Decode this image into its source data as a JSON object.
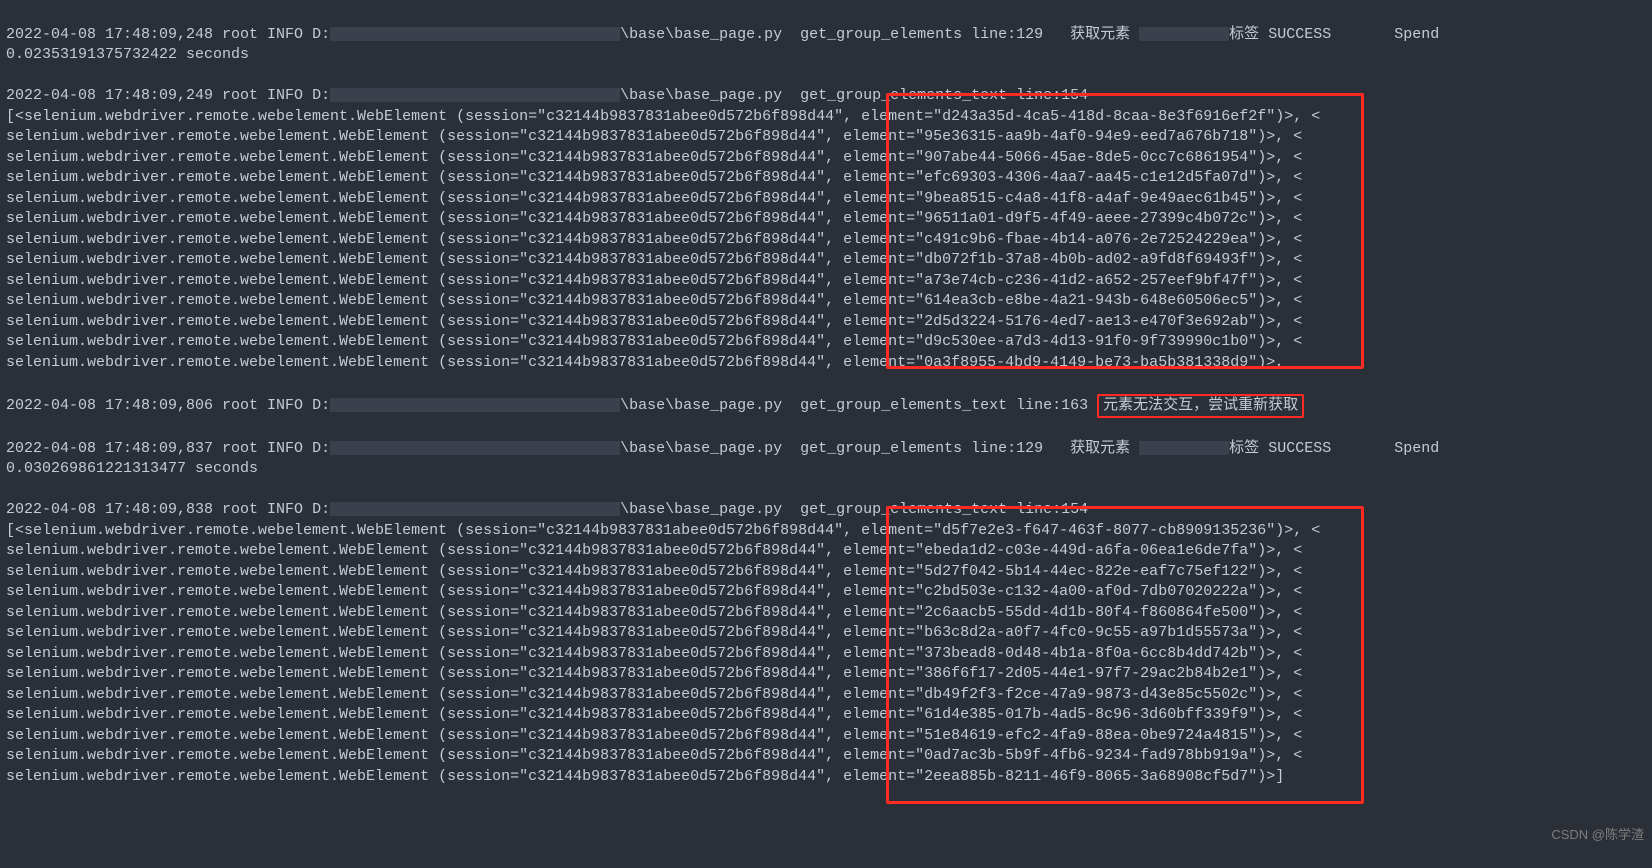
{
  "ts": {
    "a": "2022-04-08 17:48:09,248",
    "b": "2022-04-08 17:48:09,249",
    "c": "2022-04-08 17:48:09,806",
    "d": "2022-04-08 17:48:09,837",
    "e": "2022-04-08 17:48:09,838"
  },
  "labels": {
    "rootinfo": " root INFO D:",
    "basefile": "\\base\\base_page.py",
    "ge": "  get_group_elements line:129   ",
    "get154": "  get_group_elements_text line:154",
    "get163": "  get_group_elements_text line:163 ",
    "fetch": "获取元素 ",
    "tag": "标签 ",
    "success": "SUCCESS",
    "spend": "       Spend ",
    "seconds": " seconds",
    "retry": "元素无法交互，尝试重新获取"
  },
  "dur": {
    "a": "0.02353191375732422",
    "b": "0.030269861221313477"
  },
  "session": "c32144b9837831abee0d572b6f898d44",
  "prefix_first": "[<selenium.webdriver.remote.webelement.WebElement (session=\"",
  "prefix": "selenium.webdriver.remote.webelement.WebElement (session=\"",
  "mid": "\", element=\"",
  "tail_cont": "\")>, <",
  "tail_mid": "\")>, <",
  "tail_last": "\")>]",
  "block1": [
    "d243a35d-4ca5-418d-8caa-8e3f6916ef2f",
    "95e36315-aa9b-4af0-94e9-eed7a676b718",
    "907abe44-5066-45ae-8de5-0cc7c6861954",
    "efc69303-4306-4aa7-aa45-c1e12d5fa07d",
    "9bea8515-c4a8-41f8-a4af-9e49aec61b45",
    "96511a01-d9f5-4f49-aeee-27399c4b072c",
    "c491c9b6-fbae-4b14-a076-2e72524229ea",
    "db072f1b-37a8-4b0b-ad02-a9fd8f69493f",
    "a73e74cb-c236-41d2-a652-257eef9bf47f",
    "614ea3cb-e8be-4a21-943b-648e60506ec5",
    "2d5d3224-5176-4ed7-ae13-e470f3e692ab",
    "d9c530ee-a7d3-4d13-91f0-9f739990c1b0",
    "0a3f8955-4bd9-4149-be73-ba5b381338d9"
  ],
  "block2": [
    "d5f7e2e3-f647-463f-8077-cb8909135236",
    "ebeda1d2-c03e-449d-a6fa-06ea1e6de7fa",
    "5d27f042-5b14-44ec-822e-eaf7c75ef122",
    "c2bd503e-c132-4a00-af0d-7db07020222a",
    "2c6aacb5-55dd-4d1b-80f4-f860864fe500",
    "b63c8d2a-a0f7-4fc0-9c55-a97b1d55573a",
    "373bead8-0d48-4b1a-8f0a-6cc8b4dd742b",
    "386f6f17-2d05-44e1-97f7-29ac2b84b2e1",
    "db49f2f3-f2ce-47a9-9873-d43e85c5502c",
    "61d4e385-017b-4ad5-8c96-3d60bff339f9",
    "51e84619-efc2-4fa9-88ea-0be9724a4815",
    "0ad7ac3b-5b9f-4fb6-9234-fad978bb919a",
    "2eea885b-8211-46f9-8065-3a68908cf5d7"
  ],
  "credit": "CSDN @陈学渣"
}
